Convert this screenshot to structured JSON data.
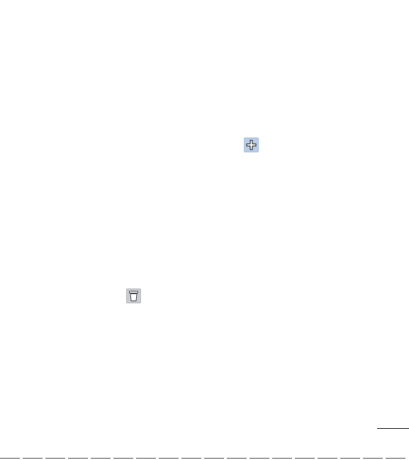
{
  "icons": {
    "add": {
      "name": "plus-icon",
      "tile_color": "#b9cde8"
    },
    "delete": {
      "name": "trash-icon",
      "tile_color": "#c9ccd1"
    }
  }
}
